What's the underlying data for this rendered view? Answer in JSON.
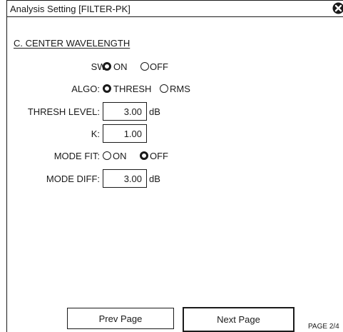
{
  "window": {
    "title": "Analysis Setting [FILTER-PK]",
    "close_icon": "close-circle-x-icon"
  },
  "section": {
    "heading": "C. CENTER WAVELENGTH"
  },
  "sw": {
    "label": "SW:",
    "options": [
      "ON",
      "OFF"
    ],
    "selected": "ON"
  },
  "algo": {
    "label": "ALGO:",
    "options": [
      "THRESH",
      "RMS"
    ],
    "selected": "THRESH"
  },
  "thresh_level": {
    "label": "THRESH LEVEL:",
    "value": "3.00",
    "unit": "dB"
  },
  "k": {
    "label": "K:",
    "value": "1.00"
  },
  "mode_fit": {
    "label": "MODE FIT:",
    "options": [
      "ON",
      "OFF"
    ],
    "selected": "OFF"
  },
  "mode_diff": {
    "label": "MODE DIFF:",
    "value": "3.00",
    "unit": "dB"
  },
  "footer": {
    "prev_label": "Prev Page",
    "next_label": "Next Page",
    "page": "PAGE 2/4"
  },
  "colors": {
    "ink": "#1a1a1a",
    "background": "#ffffff"
  }
}
